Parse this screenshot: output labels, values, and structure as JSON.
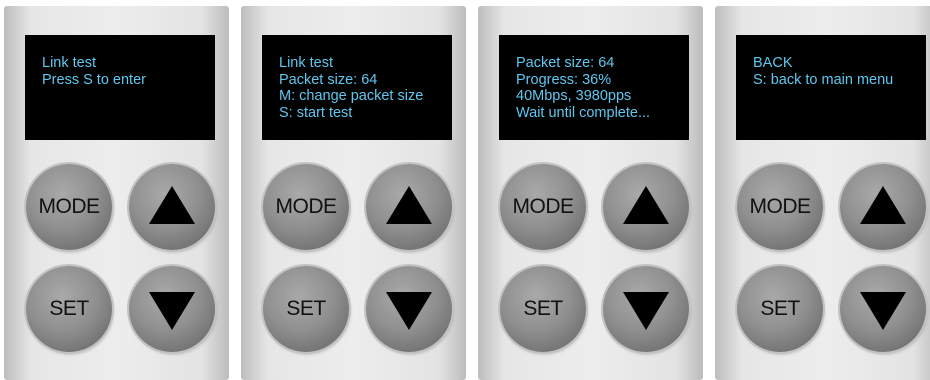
{
  "panels": [
    {
      "screen_lines": [
        "Link test",
        "Press S to enter"
      ],
      "buttons": {
        "mode": "MODE",
        "set": "SET"
      }
    },
    {
      "screen_lines": [
        "Link test",
        "Packet size: 64",
        "M: change packet size",
        "S: start test"
      ],
      "buttons": {
        "mode": "MODE",
        "set": "SET"
      }
    },
    {
      "screen_lines": [
        "Packet size: 64",
        "Progress: 36%",
        "40Mbps, 3980pps",
        "Wait until complete..."
      ],
      "buttons": {
        "mode": "MODE",
        "set": "SET"
      }
    },
    {
      "screen_lines": [
        "BACK",
        "S: back to main menu"
      ],
      "buttons": {
        "mode": "MODE",
        "set": "SET"
      }
    }
  ],
  "icons": {
    "up": "up-arrow-icon",
    "down": "down-arrow-icon"
  },
  "colors": {
    "screen_text": "#5ec8f0",
    "screen_bg": "#000000",
    "button": "#8c8c8c"
  }
}
